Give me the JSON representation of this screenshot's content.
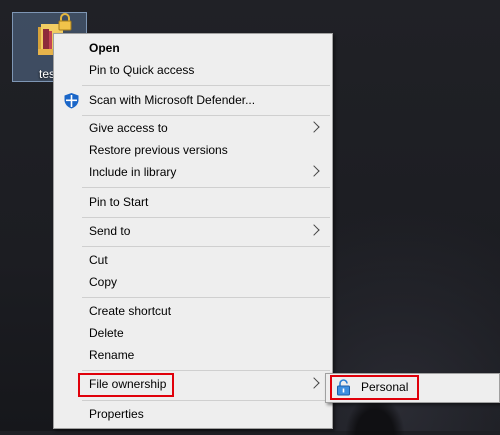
{
  "desktop": {
    "icon_label": "tes"
  },
  "context_menu": {
    "items": [
      {
        "label": "Open",
        "bold": true
      },
      {
        "label": "Pin to Quick access"
      },
      {
        "label": "Scan with Microsoft Defender..."
      },
      {
        "label": "Give access to",
        "submenu": true
      },
      {
        "label": "Restore previous versions"
      },
      {
        "label": "Include in library",
        "submenu": true
      },
      {
        "label": "Pin to Start"
      },
      {
        "label": "Send to",
        "submenu": true
      },
      {
        "label": "Cut"
      },
      {
        "label": "Copy"
      },
      {
        "label": "Create shortcut"
      },
      {
        "label": "Delete"
      },
      {
        "label": "Rename"
      },
      {
        "label": "File ownership",
        "submenu": true,
        "highlighted": true
      },
      {
        "label": "Properties"
      }
    ]
  },
  "submenu": {
    "items": [
      {
        "label": "Personal",
        "highlighted": true
      }
    ]
  },
  "colors": {
    "menu_bg": "#eeeeee",
    "highlight_border": "#e0000a",
    "defender_blue": "#1a66c8"
  }
}
